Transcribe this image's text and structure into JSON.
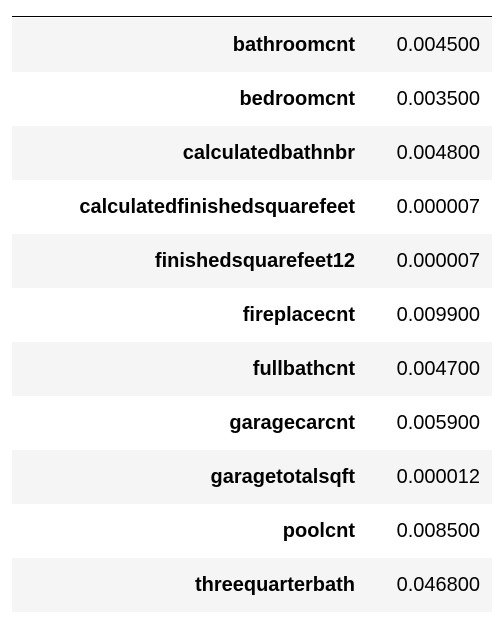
{
  "table": {
    "rows": [
      {
        "name": "bathroomcnt",
        "value": "0.004500"
      },
      {
        "name": "bedroomcnt",
        "value": "0.003500"
      },
      {
        "name": "calculatedbathnbr",
        "value": "0.004800"
      },
      {
        "name": "calculatedfinishedsquarefeet",
        "value": "0.000007"
      },
      {
        "name": "finishedsquarefeet12",
        "value": "0.000007"
      },
      {
        "name": "fireplacecnt",
        "value": "0.009900"
      },
      {
        "name": "fullbathcnt",
        "value": "0.004700"
      },
      {
        "name": "garagecarcnt",
        "value": "0.005900"
      },
      {
        "name": "garagetotalsqft",
        "value": "0.000012"
      },
      {
        "name": "poolcnt",
        "value": "0.008500"
      },
      {
        "name": "threequarterbath",
        "value": "0.046800"
      }
    ]
  }
}
